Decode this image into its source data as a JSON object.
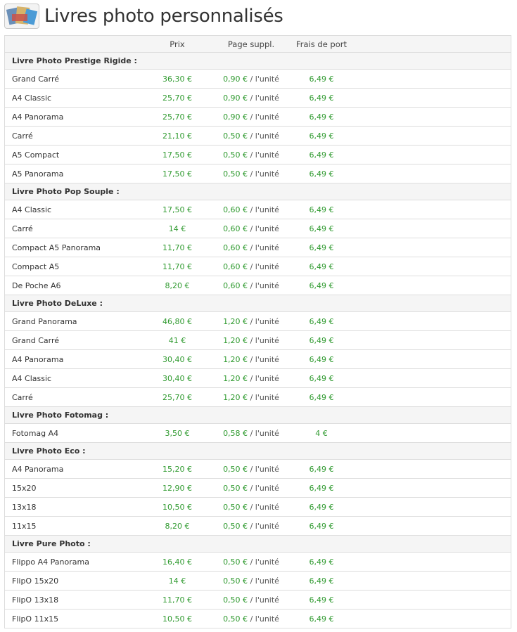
{
  "page": {
    "title": "Livres photo personnalisés"
  },
  "table": {
    "headers": {
      "prix": "Prix",
      "page_suppl": "Page suppl.",
      "frais": "Frais de port"
    },
    "per_unit": "/ l'unité",
    "rows": [
      {
        "type": "category",
        "name": "Livre Photo Prestige Rigide :"
      },
      {
        "type": "item",
        "name": "Grand Carré",
        "prix": "36,30 €",
        "page": "0,90 €",
        "frais": "6,49 €"
      },
      {
        "type": "item",
        "name": "A4 Classic",
        "prix": "25,70 €",
        "page": "0,90 €",
        "frais": "6,49 €"
      },
      {
        "type": "item",
        "name": "A4 Panorama",
        "prix": "25,70 €",
        "page": "0,90 €",
        "frais": "6,49 €"
      },
      {
        "type": "item",
        "name": "Carré",
        "prix": "21,10 €",
        "page": "0,50 €",
        "frais": "6,49 €"
      },
      {
        "type": "item",
        "name": "A5 Compact",
        "prix": "17,50 €",
        "page": "0,50 €",
        "frais": "6,49 €"
      },
      {
        "type": "item",
        "name": "A5 Panorama",
        "prix": "17,50 €",
        "page": "0,50 €",
        "frais": "6,49 €"
      },
      {
        "type": "category",
        "name": "Livre Photo Pop Souple :"
      },
      {
        "type": "item",
        "name": "A4 Classic",
        "prix": "17,50 €",
        "page": "0,60 €",
        "frais": "6,49 €"
      },
      {
        "type": "item",
        "name": "Carré",
        "prix": "14 €",
        "page": "0,60 €",
        "frais": "6,49 €"
      },
      {
        "type": "item",
        "name": "Compact A5 Panorama",
        "prix": "11,70 €",
        "page": "0,60 €",
        "frais": "6,49 €"
      },
      {
        "type": "item",
        "name": "Compact A5",
        "prix": "11,70 €",
        "page": "0,60 €",
        "frais": "6,49 €"
      },
      {
        "type": "item",
        "name": "De Poche A6",
        "prix": "8,20 €",
        "page": "0,60 €",
        "frais": "6,49 €"
      },
      {
        "type": "category",
        "name": "Livre Photo DeLuxe :"
      },
      {
        "type": "item",
        "name": "Grand Panorama",
        "prix": "46,80 €",
        "page": "1,20 €",
        "frais": "6,49 €"
      },
      {
        "type": "item",
        "name": "Grand Carré",
        "prix": "41 €",
        "page": "1,20 €",
        "frais": "6,49 €"
      },
      {
        "type": "item",
        "name": "A4 Panorama",
        "prix": "30,40 €",
        "page": "1,20 €",
        "frais": "6,49 €"
      },
      {
        "type": "item",
        "name": "A4 Classic",
        "prix": "30,40 €",
        "page": "1,20 €",
        "frais": "6,49 €"
      },
      {
        "type": "item",
        "name": "Carré",
        "prix": "25,70 €",
        "page": "1,20 €",
        "frais": "6,49 €"
      },
      {
        "type": "category",
        "name": "Livre Photo Fotomag :"
      },
      {
        "type": "item",
        "name": "Fotomag A4",
        "prix": "3,50 €",
        "page": "0,58 €",
        "frais": "4 €"
      },
      {
        "type": "category",
        "name": "Livre Photo Eco :"
      },
      {
        "type": "item",
        "name": "A4 Panorama",
        "prix": "15,20 €",
        "page": "0,50 €",
        "frais": "6,49 €"
      },
      {
        "type": "item",
        "name": "15x20",
        "prix": "12,90 €",
        "page": "0,50 €",
        "frais": "6,49 €"
      },
      {
        "type": "item",
        "name": "13x18",
        "prix": "10,50 €",
        "page": "0,50 €",
        "frais": "6,49 €"
      },
      {
        "type": "item",
        "name": "11x15",
        "prix": "8,20 €",
        "page": "0,50 €",
        "frais": "6,49 €"
      },
      {
        "type": "category",
        "name": "Livre Pure Photo :"
      },
      {
        "type": "item",
        "name": "Flippo A4 Panorama",
        "prix": "16,40 €",
        "page": "0,50 €",
        "frais": "6,49 €"
      },
      {
        "type": "item",
        "name": "FlipO 15x20",
        "prix": "14 €",
        "page": "0,50 €",
        "frais": "6,49 €"
      },
      {
        "type": "item",
        "name": "FlipO 13x18",
        "prix": "11,70 €",
        "page": "0,50 €",
        "frais": "6,49 €"
      },
      {
        "type": "item",
        "name": "FlipO 11x15",
        "prix": "10,50 €",
        "page": "0,50 €",
        "frais": "6,49 €"
      }
    ]
  },
  "colors": {
    "price": "#2f9a2f",
    "category_bg": "#f5f5f5",
    "border": "#dddddd"
  },
  "icons": {
    "logo": "photo-books-icon"
  }
}
